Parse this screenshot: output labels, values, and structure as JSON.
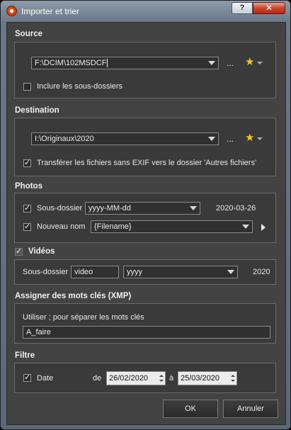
{
  "window": {
    "title": "Importer et trier",
    "help_label": "?",
    "close_label": "✕"
  },
  "source": {
    "header": "Source",
    "path": "F:\\DCIM\\102MSDCF",
    "ellipsis": "...",
    "include_subfolders_label": "Inclure les sous-dossiers",
    "include_subfolders_checked": false
  },
  "destination": {
    "header": "Destination",
    "path": "I:\\Originaux\\2020",
    "ellipsis": "...",
    "transfer_label": "Transférer les fichiers sans EXIF vers le dossier 'Autres fichiers'",
    "transfer_checked": true
  },
  "photos": {
    "header": "Photos",
    "subfolder_label": "Sous-dossier",
    "subfolder_checked": true,
    "subfolder_format": "yyyy-MM-dd",
    "subfolder_preview": "2020-03-26",
    "newname_label": "Nouveau nom",
    "newname_checked": true,
    "newname_value": "{Filename}"
  },
  "videos": {
    "header": "Vidéos",
    "checked": true,
    "subfolder_label": "Sous-dossier",
    "subfolder_name": "video",
    "subfolder_format": "yyyy",
    "subfolder_preview": "2020"
  },
  "keywords": {
    "header": "Assigner des mots clés (XMP)",
    "hint": "Utiliser ; pour séparer les mots clés",
    "value": "A_faire"
  },
  "filter": {
    "header": "Filtre",
    "date_label": "Date",
    "date_checked": true,
    "from_label": "de",
    "from_date": "26/02/2020",
    "to_label": "à",
    "to_date": "25/03/2020"
  },
  "buttons": {
    "ok": "OK",
    "cancel": "Annuler"
  },
  "colors": {
    "star": "#f5c518",
    "panel_bg": "#3a3a3a",
    "dialog_bg": "#434343"
  }
}
